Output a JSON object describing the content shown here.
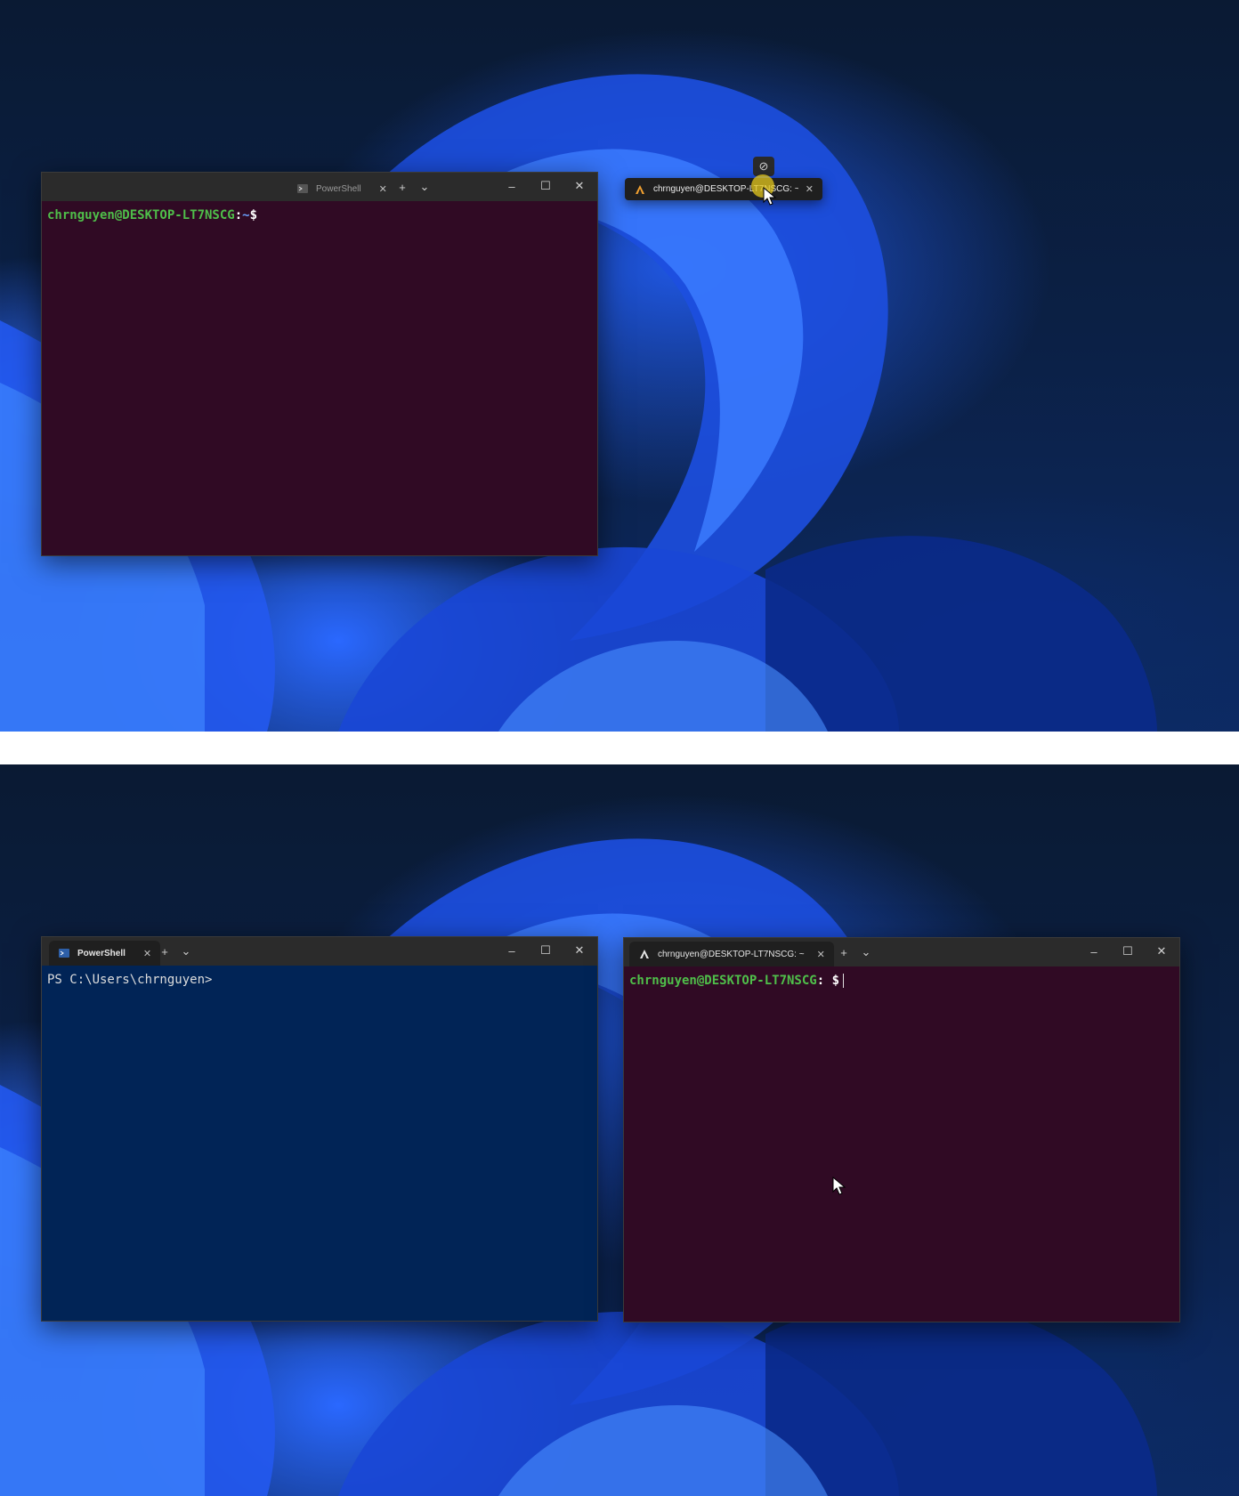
{
  "top_frame": {
    "left_window": {
      "tab_label": "PowerShell",
      "prompt_user": "chrnguyen@DESKTOP-LT7NSCG",
      "prompt_sep": ":",
      "prompt_path": "~",
      "prompt_symbol": "$"
    },
    "dragged_tab": {
      "label": "chrnguyen@DESKTOP-LT7NSCG: ~"
    }
  },
  "bottom_frame": {
    "left_window": {
      "tab_label": "PowerShell",
      "prompt": "PS C:\\Users\\chrnguyen>"
    },
    "right_window": {
      "tab_label": "chrnguyen@DESKTOP-LT7NSCG: ~",
      "prompt_user": "chrnguyen@DESKTOP-LT7NSCG",
      "prompt_sep": ": ",
      "prompt_symbol": "$"
    }
  },
  "titlebar_controls": {
    "new_tab": "+",
    "dropdown": "⌄",
    "minimize": "–",
    "maximize": "☐",
    "close": "✕",
    "tab_close": "✕"
  },
  "colors": {
    "ubuntu_bg": "#300a24",
    "powershell_bg": "#012456",
    "prompt_green": "#4fbf4a"
  }
}
